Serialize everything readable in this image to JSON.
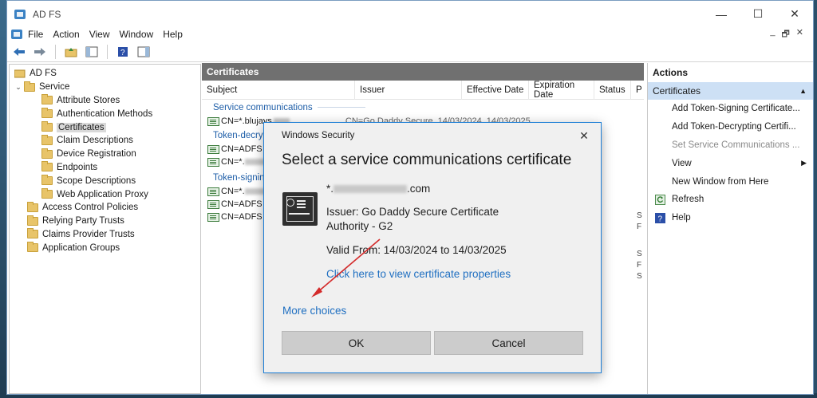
{
  "window": {
    "title": "AD FS",
    "controls": [
      "—",
      "☐",
      "✕"
    ]
  },
  "menu": [
    "File",
    "Action",
    "View",
    "Window",
    "Help"
  ],
  "mdi_controls": [
    "_",
    "🗗",
    "✕"
  ],
  "tree": {
    "root": "AD FS",
    "service": "Service",
    "service_children": [
      "Attribute Stores",
      "Authentication Methods",
      "Certificates",
      "Claim Descriptions",
      "Device Registration",
      "Endpoints",
      "Scope Descriptions",
      "Web Application Proxy"
    ],
    "others": [
      "Access Control Policies",
      "Relying Party Trusts",
      "Claims Provider Trusts",
      "Application Groups"
    ]
  },
  "center": {
    "header": "Certificates",
    "columns": [
      "Subject",
      "Issuer",
      "Effective Date",
      "Expiration Date",
      "Status",
      "P"
    ],
    "groups": {
      "service": "Service communications",
      "decrypting": "Token-decryp",
      "signing": "Token-signin"
    },
    "rows": {
      "service_row": "CN=*.blujays",
      "decrypt_1": "CN=ADFS E",
      "decrypt_2": "CN=*.",
      "sign_1": "CN=*.",
      "sign_2": "CN=ADFS S",
      "sign_3": "CN=ADFS S"
    },
    "row_trailing": {
      "issuer": "CN=Go Daddy Secure",
      "effective": "14/03/2024",
      "expiration": "14/03/2025"
    },
    "right_marks": [
      "S",
      "F",
      "S",
      "F",
      "S"
    ]
  },
  "actions": {
    "header": "Actions",
    "section": "Certificates",
    "items": [
      {
        "label": "Add Token-Signing Certificate...",
        "disabled": false,
        "icon": ""
      },
      {
        "label": "Add Token-Decrypting Certifi...",
        "disabled": false,
        "icon": ""
      },
      {
        "label": "Set Service Communications ...",
        "disabled": true,
        "icon": ""
      },
      {
        "label": "View",
        "disabled": false,
        "icon": "",
        "submenu": true
      },
      {
        "label": "New Window from Here",
        "disabled": false,
        "icon": ""
      },
      {
        "label": "Refresh",
        "disabled": false,
        "icon": "refresh-icon"
      },
      {
        "label": "Help",
        "disabled": false,
        "icon": "help-icon"
      }
    ]
  },
  "dialog": {
    "title": "Windows Security",
    "heading": "Select a service communications certificate",
    "cert_name_prefix": "*.",
    "cert_name_suffix": ".com",
    "issuer_line1": "Issuer: Go Daddy Secure Certificate",
    "issuer_line2": "Authority - G2",
    "valid": "Valid From: 14/03/2024 to 14/03/2025",
    "properties_link": "Click here to view certificate properties",
    "more_choices": "More choices",
    "ok": "OK",
    "cancel": "Cancel"
  },
  "colors": {
    "header_gray": "#707070",
    "link_blue": "#1f6fc1",
    "selection_blue": "#cde0f5",
    "annotation_red": "#d42a2a"
  }
}
